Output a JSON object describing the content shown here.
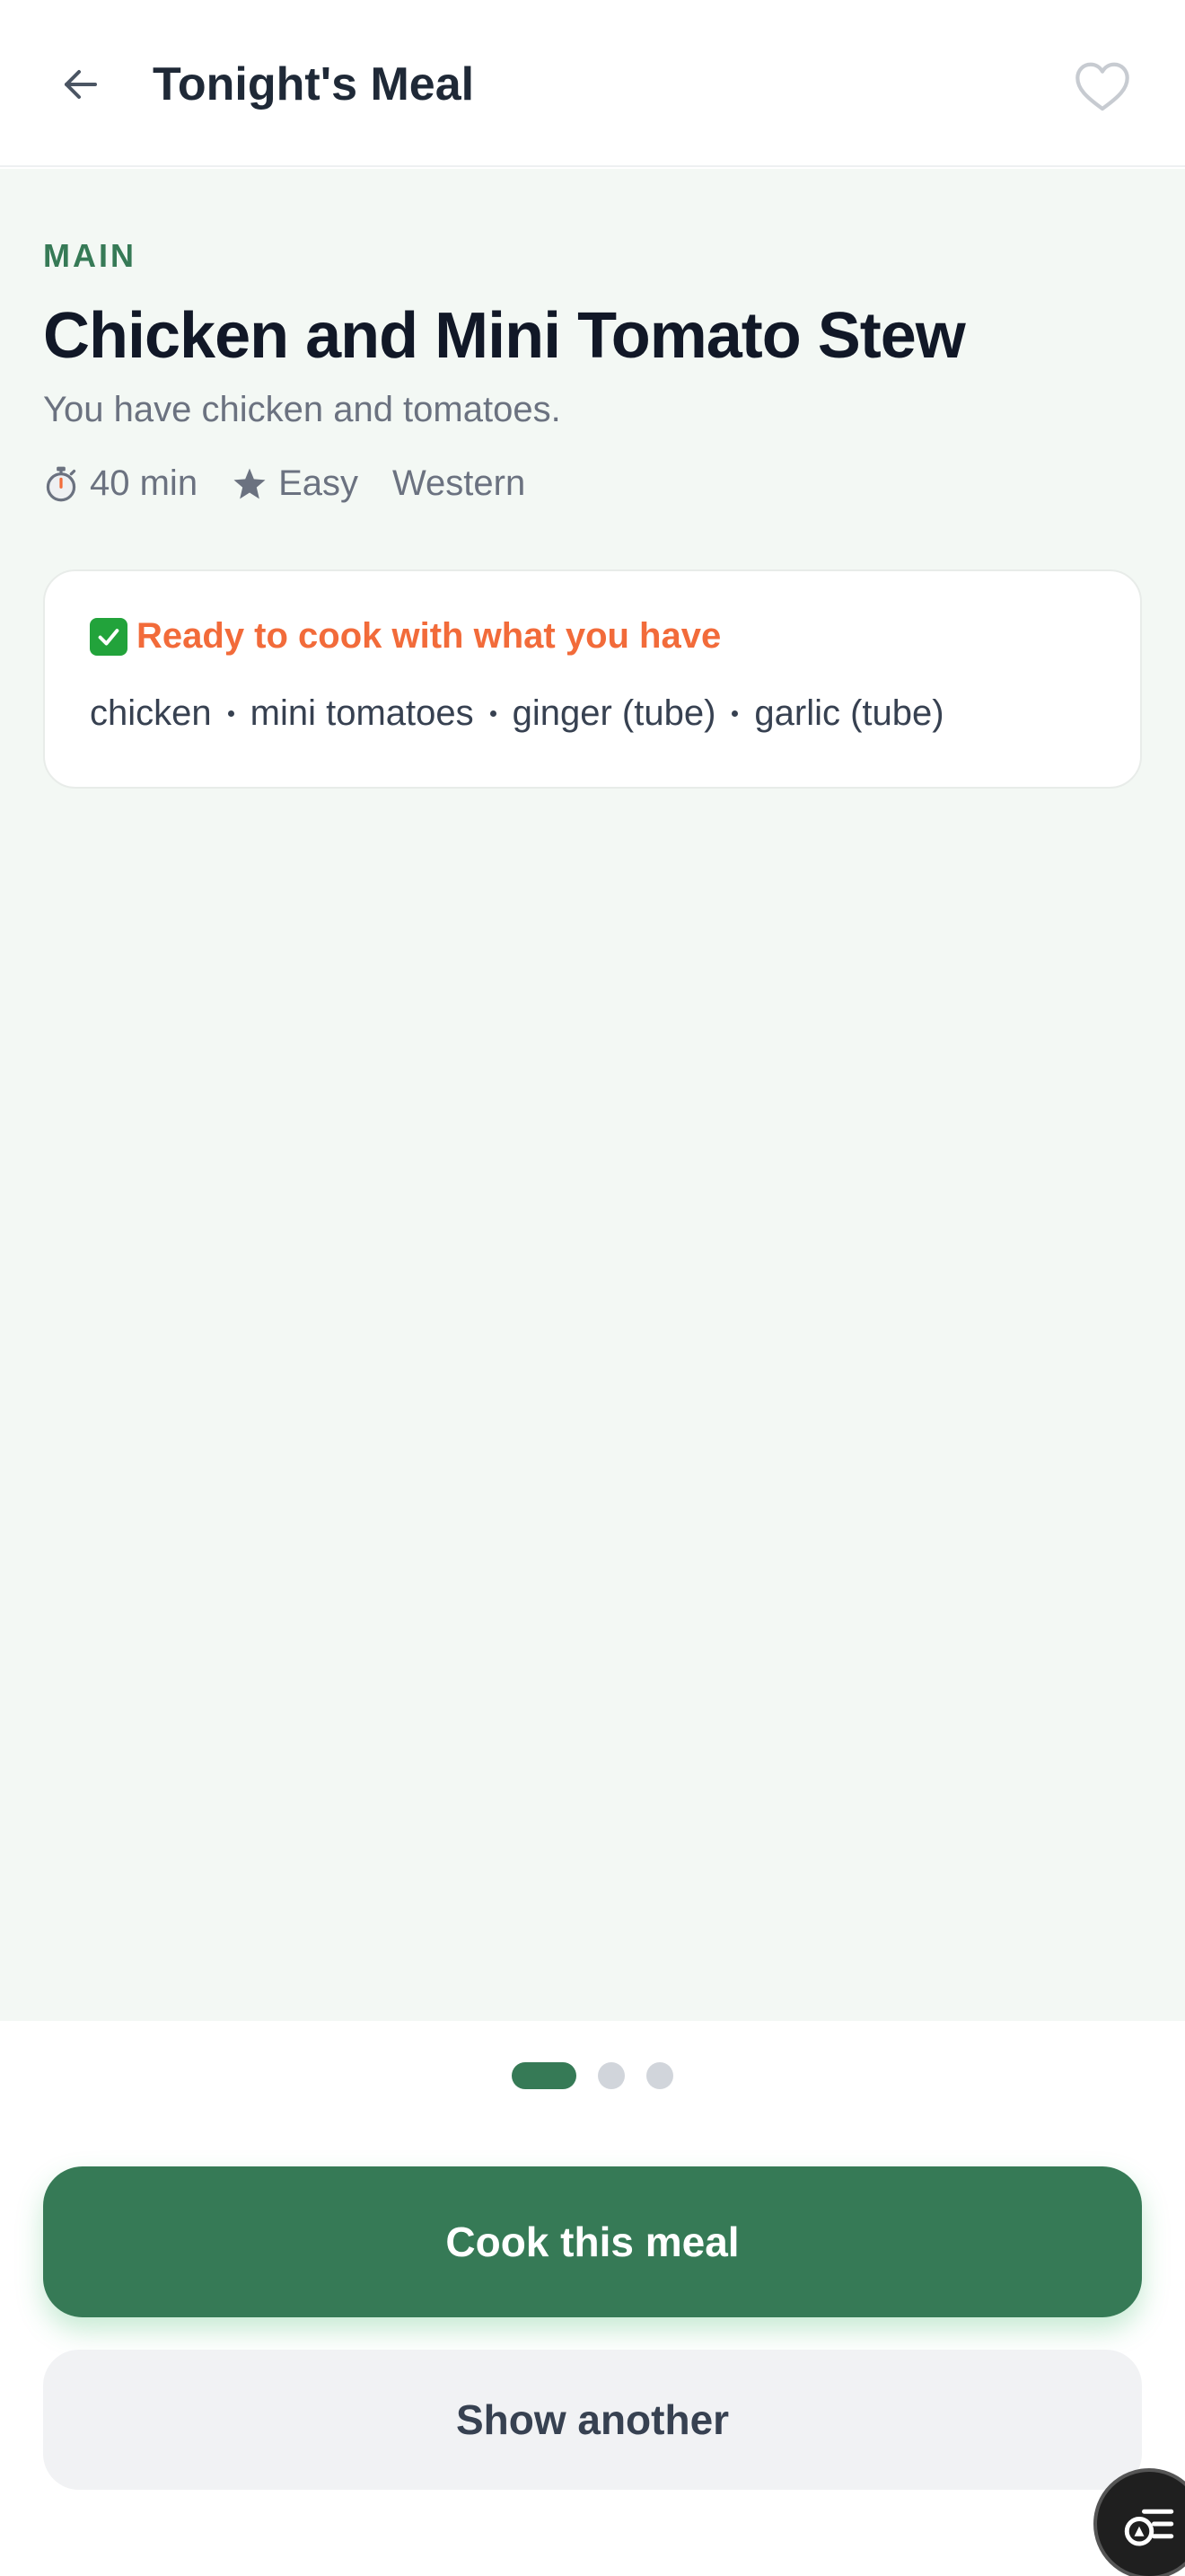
{
  "header": {
    "title": "Tonight's Meal",
    "back_icon": "arrow-left-icon",
    "favorite_icon": "heart-outline-icon"
  },
  "recipe": {
    "category": "MAIN",
    "title": "Chicken and Mini Tomato Stew",
    "subtitle": "You have chicken and tomatoes.",
    "time": "40 min",
    "difficulty": "Easy",
    "cuisine": "Western"
  },
  "ready_card": {
    "title": "Ready to cook with what you have",
    "ingredients": [
      "chicken",
      "mini tomatoes",
      "ginger (tube)",
      "garlic (tube)"
    ]
  },
  "pager": {
    "total": 3,
    "active_index": 0
  },
  "actions": {
    "primary_label": "Cook this meal",
    "secondary_label": "Show another"
  },
  "colors": {
    "brand_green": "#367a56",
    "accent_orange": "#f26b3a",
    "background_tint": "#f3f8f4"
  }
}
